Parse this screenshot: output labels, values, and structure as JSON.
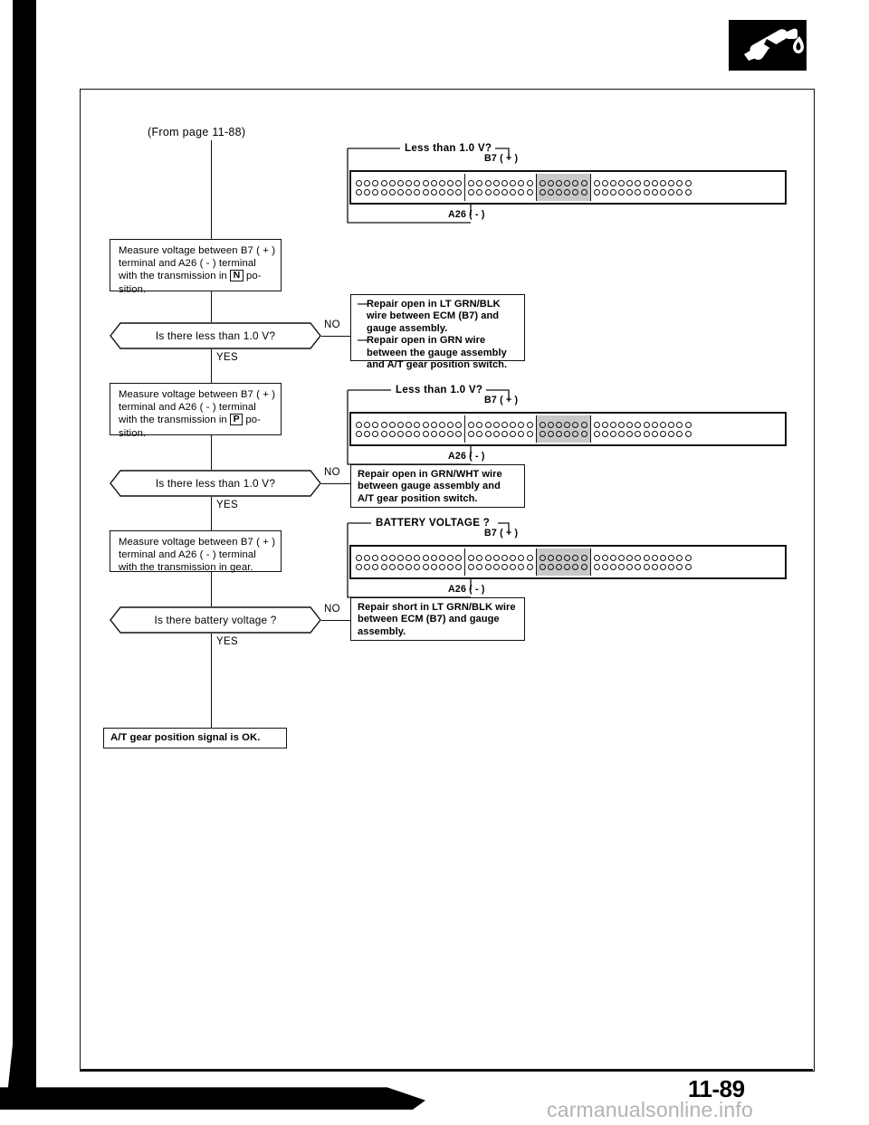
{
  "document": {
    "page_number": "11-89",
    "watermark": "carmanualsonline.info",
    "logo_icon": "fuel-nozzle-icon"
  },
  "flow": {
    "from_page": "(From page 11-88)",
    "steps": [
      {
        "id": "measure-n",
        "text_lines": [
          "Measure voltage between B7 ( + )",
          "terminal and A26 ( - ) terminal",
          "with the transmission in",
          "position."
        ],
        "gear_key": "N",
        "text_before_key": "with the transmission in",
        "text_after_key": "po-",
        "text_last": "sition."
      },
      {
        "id": "measure-p",
        "gear_key": "P",
        "text_before_key": "with the transmission in",
        "text_after_key": "po-",
        "text_last": "sition."
      },
      {
        "id": "measure-gear",
        "line1": "Measure voltage between B7 ( + )",
        "line2": "terminal and A26 ( - ) terminal",
        "line3": "with the transmission in gear."
      }
    ],
    "measure_common": {
      "line1": "Measure voltage between B7 ( + )",
      "line2": "terminal and A26 ( - ) terminal"
    },
    "decisions": [
      {
        "id": "q-n",
        "label": "Is there less than 1.0 V?",
        "no": "NO",
        "yes": "YES"
      },
      {
        "id": "q-p",
        "label": "Is there less than 1.0 V?",
        "no": "NO",
        "yes": "YES"
      },
      {
        "id": "q-batt",
        "label": "Is there battery voltage ?",
        "no": "NO",
        "yes": "YES"
      }
    ],
    "outcome": "A/T gear position signal is OK."
  },
  "results": [
    {
      "id": "repair-lt-grn-blk-open",
      "bullets": [
        "Repair open in LT GRN/BLK wire between ECM (B7) and gauge assembly.",
        "Repair open in GRN wire between the gauge assembly and A/T gear position switch."
      ]
    },
    {
      "id": "repair-grn-wht-open",
      "text": "Repair open in GRN/WHT wire between gauge assembly and A/T gear position switch."
    },
    {
      "id": "repair-lt-grn-blk-short",
      "text": "Repair short in LT GRN/BLK wire between ECM (B7) and gauge assembly."
    }
  ],
  "connectors": [
    {
      "id": "connector-1",
      "question": "Less than 1.0 V?",
      "positive_terminal": "B7 ( + )",
      "negative_terminal": "A26 ( - )",
      "segments": [
        {
          "pins_per_row": 13,
          "rows": 2,
          "shaded": false
        },
        {
          "pins_per_row": 8,
          "rows": 2,
          "shaded": false
        },
        {
          "pins_per_row": 6,
          "rows": 2,
          "shaded": true
        },
        {
          "pins_per_row": 12,
          "rows": 2,
          "shaded": false
        }
      ]
    },
    {
      "id": "connector-2",
      "question": "Less than 1.0 V?",
      "positive_terminal": "B7 ( + )",
      "negative_terminal": "A26 ( - )",
      "segments": [
        {
          "pins_per_row": 13,
          "rows": 2,
          "shaded": false
        },
        {
          "pins_per_row": 8,
          "rows": 2,
          "shaded": false
        },
        {
          "pins_per_row": 6,
          "rows": 2,
          "shaded": true
        },
        {
          "pins_per_row": 12,
          "rows": 2,
          "shaded": false
        }
      ]
    },
    {
      "id": "connector-3",
      "question": "BATTERY VOLTAGE ?",
      "positive_terminal": "B7 ( + )",
      "negative_terminal": "A26 ( - )",
      "segments": [
        {
          "pins_per_row": 13,
          "rows": 2,
          "shaded": false
        },
        {
          "pins_per_row": 8,
          "rows": 2,
          "shaded": false
        },
        {
          "pins_per_row": 6,
          "rows": 2,
          "shaded": true
        },
        {
          "pins_per_row": 12,
          "rows": 2,
          "shaded": false
        }
      ]
    }
  ]
}
